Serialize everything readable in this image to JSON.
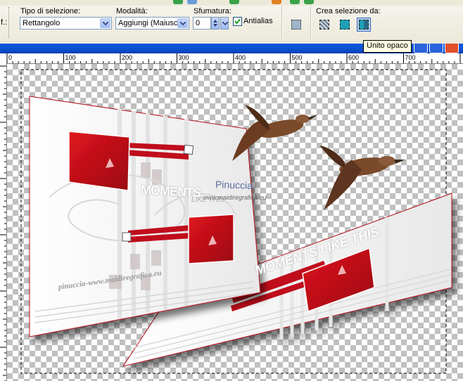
{
  "toolbar": {
    "left_cut_label": "f.:",
    "selection_type": {
      "label": "Tipo di selezione:",
      "value": "Rettangolo"
    },
    "mode": {
      "label": "Modalità:",
      "value": "Aggiungi (Maiusc)"
    },
    "feather": {
      "label": "Sfumatura:",
      "value": "0"
    },
    "antialias": {
      "label": "Antialias",
      "checked": true
    },
    "create_from": {
      "label": "Crea selezione da:",
      "buttons": [
        "layer-selection-icon",
        "opaque-selection-icon",
        "merged-opaque-icon"
      ]
    },
    "tooltip": "Unito opaco"
  },
  "ruler": {
    "ticks": [
      "0",
      "100",
      "200",
      "300",
      "400",
      "500",
      "600",
      "700"
    ]
  },
  "artwork": {
    "watermark_name": "Pinuccia",
    "watermark_site": "www.maidiregrafica.eu",
    "footer_signature": "pinuccia-www.maidiregrafica.eu",
    "moments_left": "MOMENTS",
    "like_this_left": "LIKE THIS",
    "moments_right": "MOMENTS LIKE THIS",
    "colors": {
      "accent_red": "#c0101a",
      "canvas_check": "#c0c0c0",
      "titlebar": "#0b4fd0"
    }
  }
}
